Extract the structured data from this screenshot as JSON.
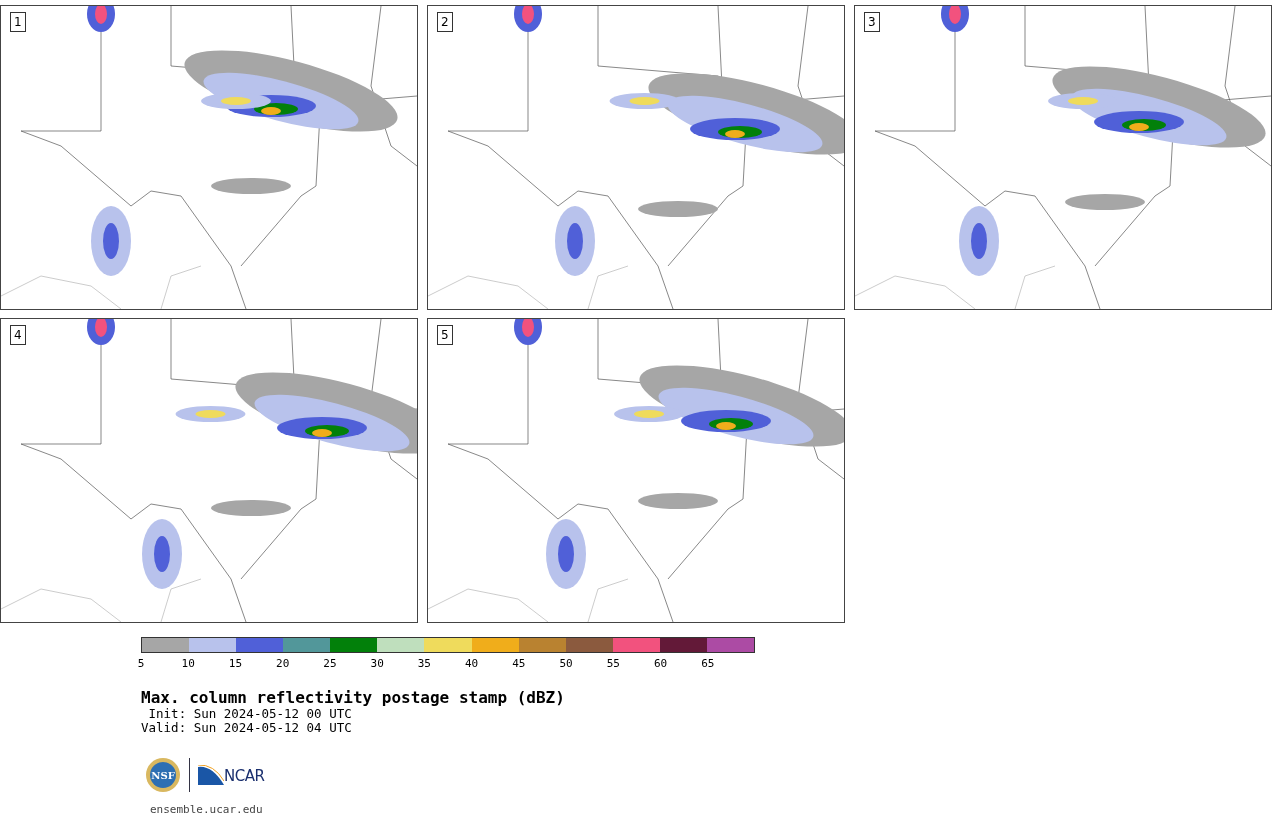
{
  "panels": [
    {
      "label": "1"
    },
    {
      "label": "2"
    },
    {
      "label": "3"
    },
    {
      "label": "4"
    },
    {
      "label": "5"
    }
  ],
  "colorbar": {
    "segments": [
      {
        "color": "#a6a6a6"
      },
      {
        "color": "#b8c2ec"
      },
      {
        "color": "#5060d8"
      },
      {
        "color": "#52979a"
      },
      {
        "color": "#02800a"
      },
      {
        "color": "#bfdfbd"
      },
      {
        "color": "#efdb5c"
      },
      {
        "color": "#f0ad1b"
      },
      {
        "color": "#b98230"
      },
      {
        "color": "#8b5a3e"
      },
      {
        "color": "#f2527e"
      },
      {
        "color": "#631938"
      },
      {
        "color": "#ac4ba4"
      }
    ],
    "ticks": [
      "5",
      "10",
      "15",
      "20",
      "25",
      "30",
      "35",
      "40",
      "45",
      "50",
      "55",
      "60",
      "65"
    ]
  },
  "title": "Max. column reflectivity postage stamp (dBZ)",
  "init": " Init: Sun 2024-05-12 00 UTC",
  "valid": "Valid: Sun 2024-05-12 04 UTC",
  "logos": {
    "nsf": "NSF",
    "ncar": "NCAR"
  },
  "url": "ensemble.ucar.edu"
}
